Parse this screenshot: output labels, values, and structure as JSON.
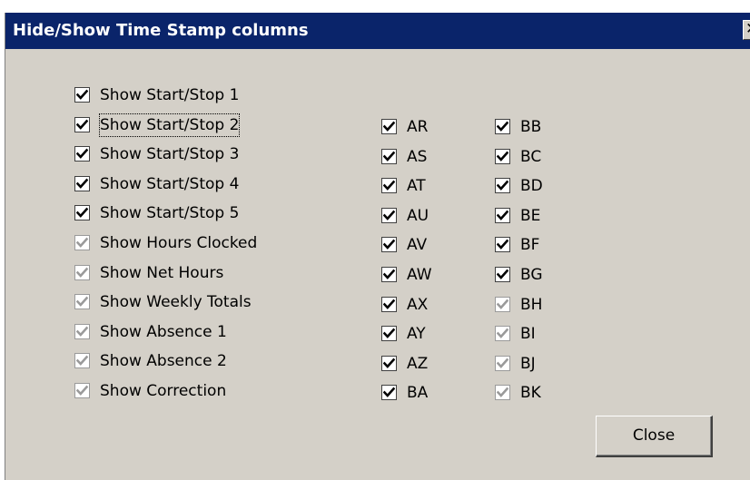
{
  "window": {
    "title": "Hide/Show Time Stamp columns",
    "close_glyph": "✕"
  },
  "col1": [
    {
      "label": "Show Start/Stop 1",
      "checked": true,
      "disabled": false
    },
    {
      "label": "Show Start/Stop 2",
      "checked": true,
      "disabled": false,
      "focused": true
    },
    {
      "label": "Show Start/Stop 3",
      "checked": true,
      "disabled": false
    },
    {
      "label": "Show Start/Stop 4",
      "checked": true,
      "disabled": false
    },
    {
      "label": "Show Start/Stop 5",
      "checked": true,
      "disabled": false
    },
    {
      "label": "Show Hours Clocked",
      "checked": true,
      "disabled": true
    },
    {
      "label": "Show Net Hours",
      "checked": true,
      "disabled": true
    },
    {
      "label": "Show Weekly Totals",
      "checked": true,
      "disabled": true
    },
    {
      "label": "Show Absence 1",
      "checked": true,
      "disabled": true
    },
    {
      "label": "Show Absence 2",
      "checked": true,
      "disabled": true
    },
    {
      "label": "Show Correction",
      "checked": true,
      "disabled": true
    }
  ],
  "col2": [
    {
      "label": "AR",
      "checked": true,
      "disabled": false
    },
    {
      "label": "AS",
      "checked": true,
      "disabled": false
    },
    {
      "label": "AT",
      "checked": true,
      "disabled": false
    },
    {
      "label": "AU",
      "checked": true,
      "disabled": false
    },
    {
      "label": "AV",
      "checked": true,
      "disabled": false
    },
    {
      "label": "AW",
      "checked": true,
      "disabled": false
    },
    {
      "label": "AX",
      "checked": true,
      "disabled": false
    },
    {
      "label": "AY",
      "checked": true,
      "disabled": false
    },
    {
      "label": "AZ",
      "checked": true,
      "disabled": false
    },
    {
      "label": "BA",
      "checked": true,
      "disabled": false
    }
  ],
  "col3": [
    {
      "label": "BB",
      "checked": true,
      "disabled": false
    },
    {
      "label": "BC",
      "checked": true,
      "disabled": false
    },
    {
      "label": "BD",
      "checked": true,
      "disabled": false
    },
    {
      "label": "BE",
      "checked": true,
      "disabled": false
    },
    {
      "label": "BF",
      "checked": true,
      "disabled": false
    },
    {
      "label": "BG",
      "checked": true,
      "disabled": false
    },
    {
      "label": "BH",
      "checked": true,
      "disabled": true
    },
    {
      "label": "BI",
      "checked": true,
      "disabled": true
    },
    {
      "label": "BJ",
      "checked": true,
      "disabled": true
    },
    {
      "label": "BK",
      "checked": true,
      "disabled": true
    }
  ],
  "buttons": {
    "close_label": "Close"
  },
  "colors": {
    "titlebar": "#0a246a",
    "dialog_bg": "#d4d0c8",
    "check_enabled": "#000000",
    "check_disabled": "#9a9a9a"
  }
}
